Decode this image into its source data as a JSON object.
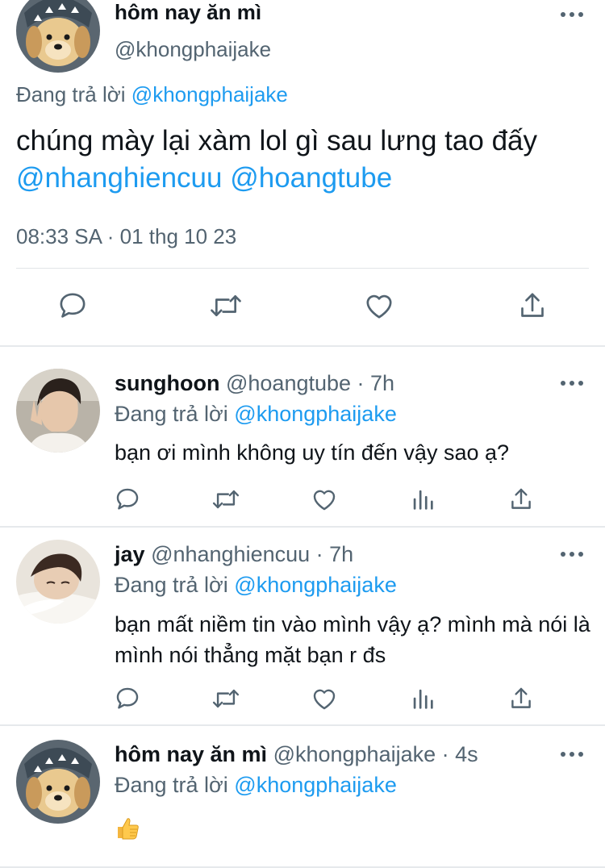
{
  "main_tweet": {
    "author_name": "hôm nay ăn mì",
    "author_handle": "@khongphaijake",
    "replying_label": "Đang trả lời",
    "replying_to": "@khongphaijake",
    "text_plain": "chúng mày lại xàm lol gì sau lưng tao đấy",
    "mention_1": "@nhanghiencuu",
    "mention_2": "@hoangtube",
    "timestamp": "08:33 SA · 01 thg 10 23",
    "actions": [
      "reply-icon",
      "retweet-icon",
      "like-icon",
      "share-icon"
    ]
  },
  "replies": [
    {
      "name": "sunghoon",
      "handle": "@hoangtube",
      "time": "· 7h",
      "replying_label": "Đang trả lời",
      "replying_to": "@khongphaijake",
      "text": "bạn ơi mình không uy tín đến vậy sao ạ?"
    },
    {
      "name": "jay",
      "handle": "@nhanghiencuu",
      "time": "· 7h",
      "replying_label": "Đang trả lời",
      "replying_to": "@khongphaijake",
      "text": "bạn mất niềm tin vào mình vậy ạ? mình mà nói là mình nói thẳng mặt bạn r đs"
    },
    {
      "name": "hôm nay ăn mì",
      "handle": "@khongphaijake",
      "time": "· 4s",
      "replying_label": "Đang trả lời",
      "replying_to": "@khongphaijake",
      "emoji": "thumbs-up"
    }
  ],
  "colors": {
    "link": "#1d9bf0",
    "secondary_text": "#536471",
    "primary_text": "#0f1419",
    "icon": "#536471"
  }
}
